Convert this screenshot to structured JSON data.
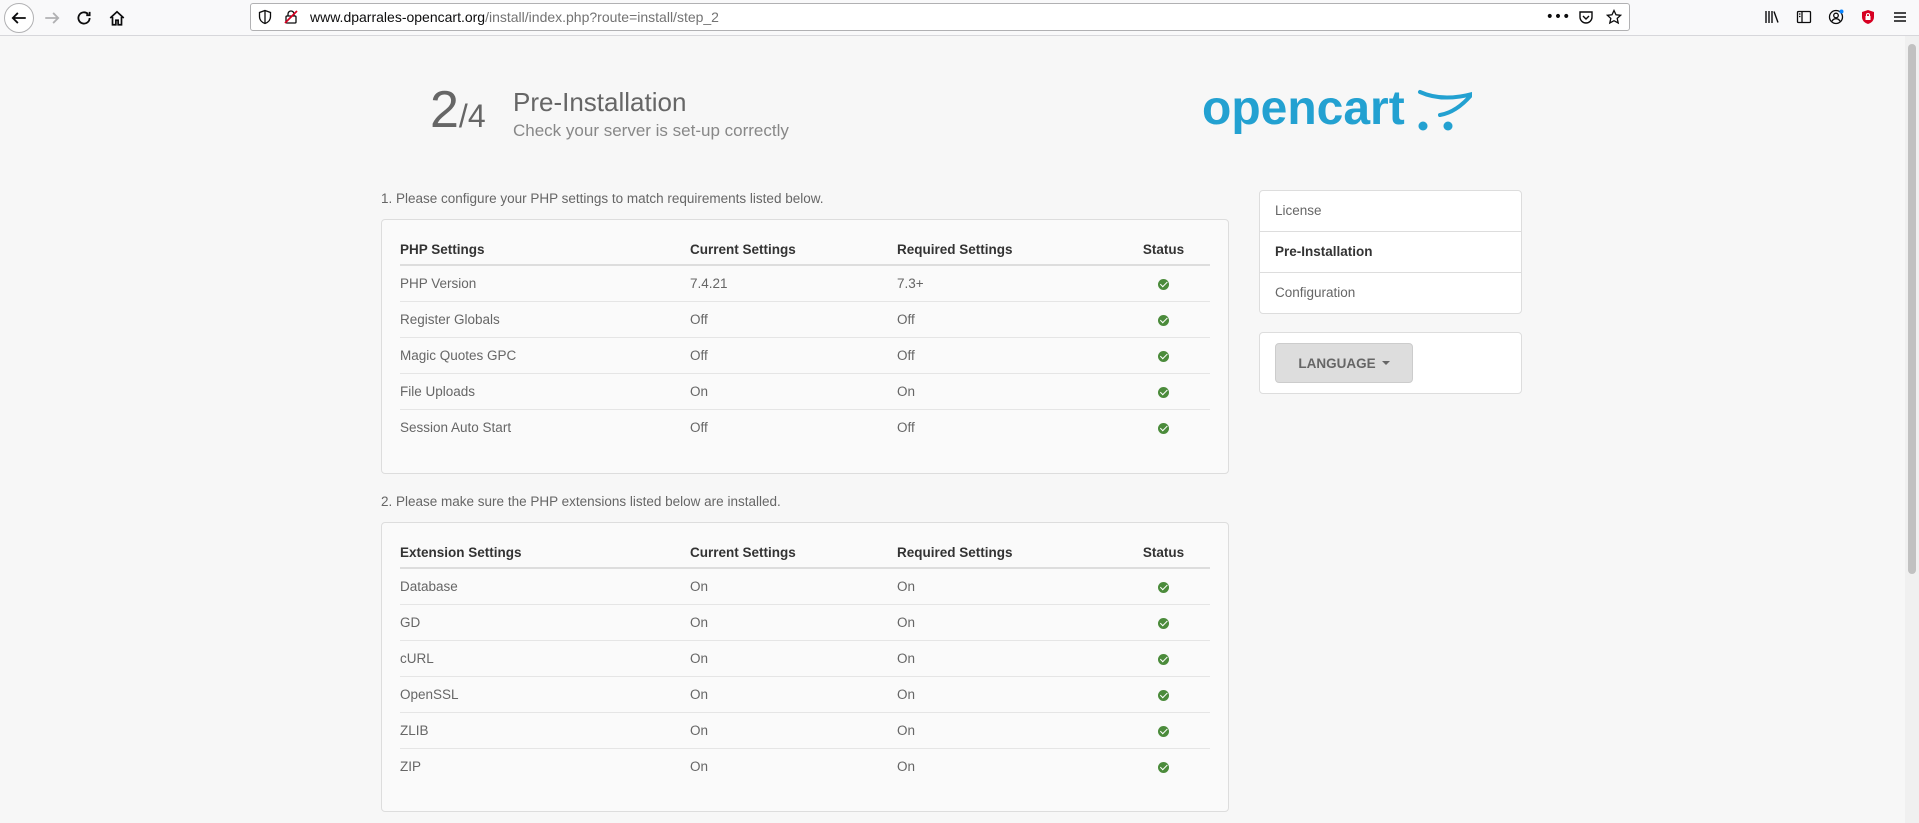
{
  "browser": {
    "url_domain": "www.dparrales-opencart.org",
    "url_path": "/install/index.php?route=install/step_2",
    "more_label": "•••"
  },
  "header": {
    "step_current": "2",
    "step_total": "/4",
    "title": "Pre-Installation",
    "subtitle": "Check your server is set-up correctly",
    "logo_text": "opencart"
  },
  "php_section": {
    "label": "1. Please configure your PHP settings to match requirements listed below.",
    "columns": [
      "PHP Settings",
      "Current Settings",
      "Required Settings",
      "Status"
    ],
    "rows": [
      {
        "name": "PHP Version",
        "current": "7.4.21",
        "required": "7.3+",
        "status": "ok"
      },
      {
        "name": "Register Globals",
        "current": "Off",
        "required": "Off",
        "status": "ok"
      },
      {
        "name": "Magic Quotes GPC",
        "current": "Off",
        "required": "Off",
        "status": "ok"
      },
      {
        "name": "File Uploads",
        "current": "On",
        "required": "On",
        "status": "ok"
      },
      {
        "name": "Session Auto Start",
        "current": "Off",
        "required": "Off",
        "status": "ok"
      }
    ]
  },
  "ext_section": {
    "label": "2. Please make sure the PHP extensions listed below are installed.",
    "columns": [
      "Extension Settings",
      "Current Settings",
      "Required Settings",
      "Status"
    ],
    "rows": [
      {
        "name": "Database",
        "current": "On",
        "required": "On",
        "status": "ok"
      },
      {
        "name": "GD",
        "current": "On",
        "required": "On",
        "status": "ok"
      },
      {
        "name": "cURL",
        "current": "On",
        "required": "On",
        "status": "ok"
      },
      {
        "name": "OpenSSL",
        "current": "On",
        "required": "On",
        "status": "ok"
      },
      {
        "name": "ZLIB",
        "current": "On",
        "required": "On",
        "status": "ok"
      },
      {
        "name": "ZIP",
        "current": "On",
        "required": "On",
        "status": "ok"
      }
    ]
  },
  "sidebar": {
    "steps": [
      "License",
      "Pre-Installation",
      "Configuration"
    ],
    "active_step": "Pre-Installation",
    "language_label": "LANGUAGE"
  },
  "colors": {
    "logo": "#23a1d1",
    "status_ok": "#4b8b3b"
  }
}
